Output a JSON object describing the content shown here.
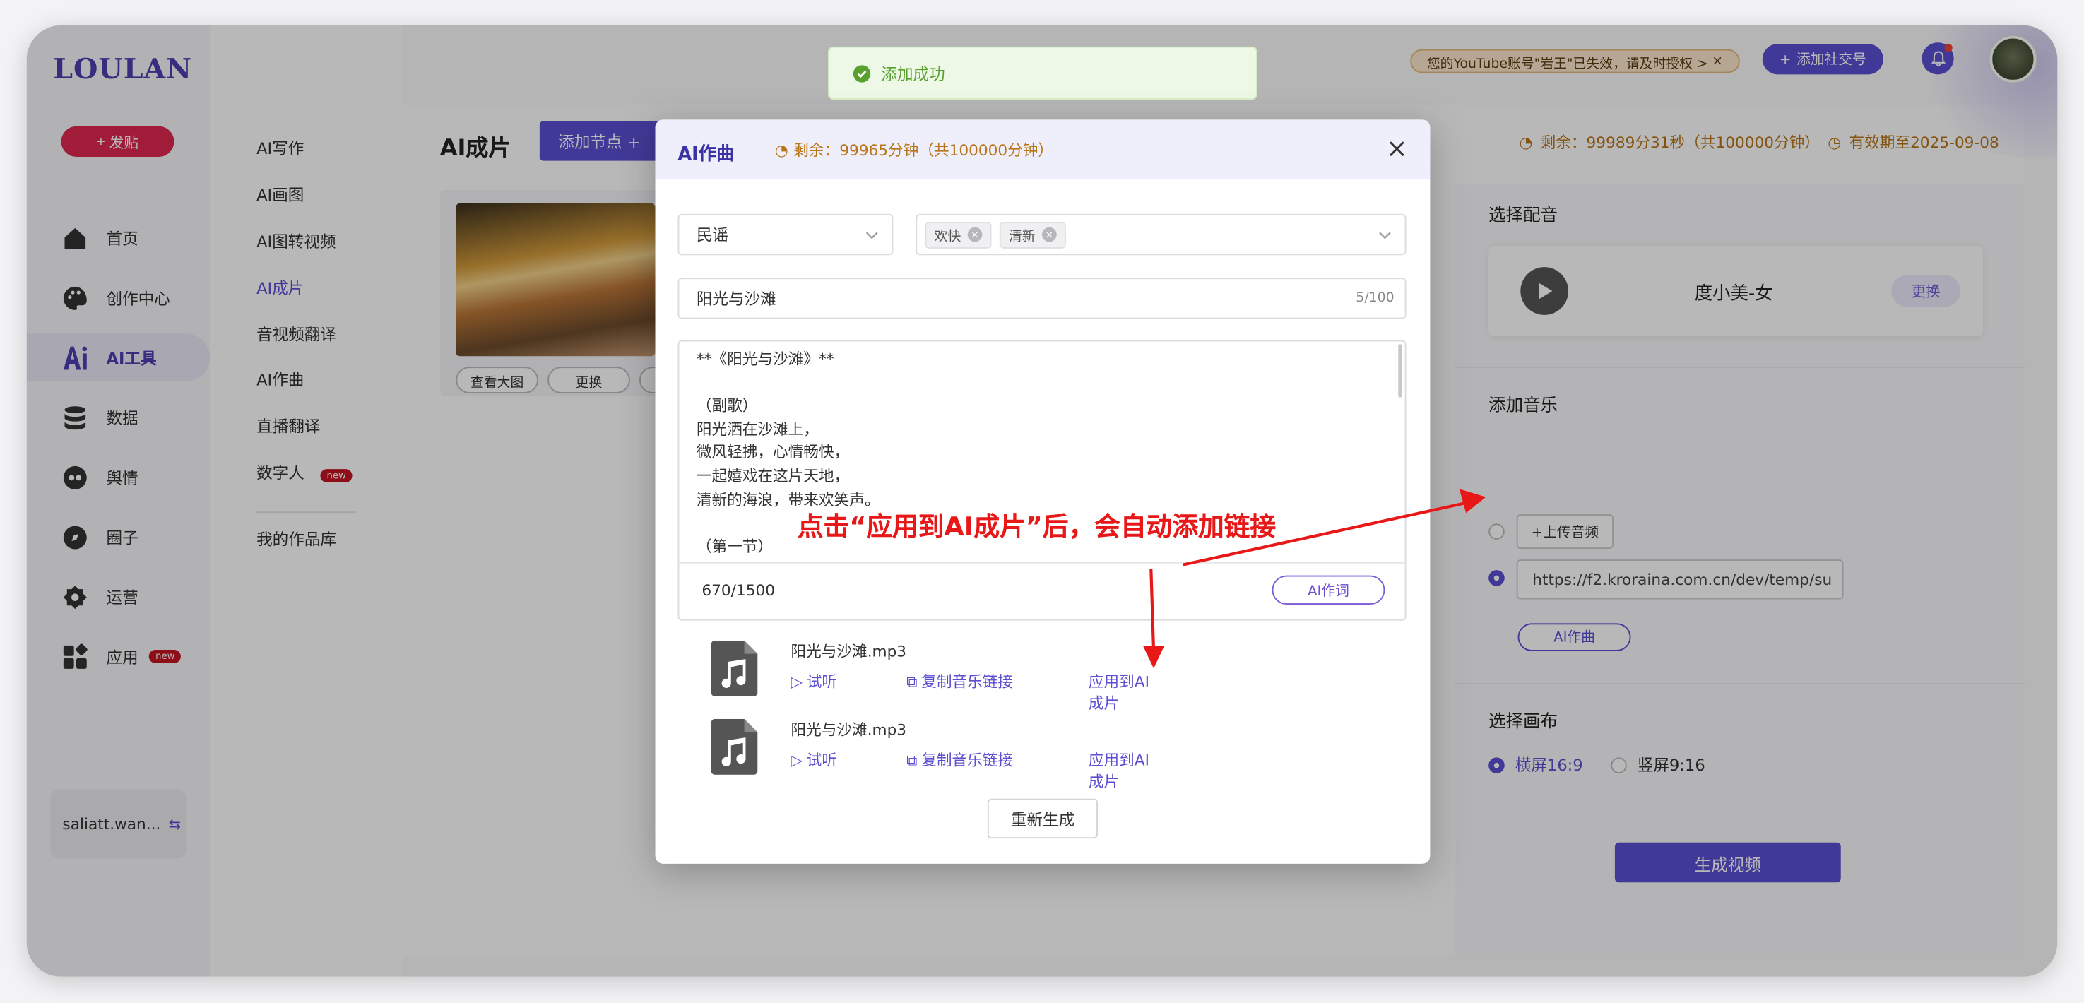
{
  "app": {
    "logo": "LOULAN",
    "post_label": "发贴"
  },
  "nav": [
    {
      "label": "首页",
      "icon": "home-icon"
    },
    {
      "label": "创作中心",
      "icon": "palette-icon"
    },
    {
      "label": "AI工具",
      "icon": "ai-icon",
      "active": true
    },
    {
      "label": "数据",
      "icon": "database-icon"
    },
    {
      "label": "舆情",
      "icon": "eye-icon"
    },
    {
      "label": "圈子",
      "icon": "compass-icon"
    },
    {
      "label": "运营",
      "icon": "operations-icon"
    },
    {
      "label": "应用",
      "icon": "apps-icon",
      "badge": "new"
    }
  ],
  "user": {
    "name": "saliatt.wan..."
  },
  "submenu": [
    {
      "label": "AI写作"
    },
    {
      "label": "AI画图"
    },
    {
      "label": "AI图转视频"
    },
    {
      "label": "AI成片",
      "active": true
    },
    {
      "label": "音视频翻译"
    },
    {
      "label": "AI作曲"
    },
    {
      "label": "直播翻译"
    },
    {
      "label": "数字人",
      "badge": "new"
    },
    {
      "label": "我的作品库"
    }
  ],
  "topbar": {
    "toast": "添加成功",
    "youtube_alert": "您的YouTube账号\"岩王\"已失效，请及时授权 >",
    "add_social": "添加社交号"
  },
  "main": {
    "title": "AI成片",
    "add_node": "添加节点 +",
    "card_buttons": [
      "查看大图",
      "更换"
    ],
    "remain": "剩余：99989分31秒（共100000分钟）",
    "valid_until": "有效期至2025-09-08"
  },
  "right": {
    "voice_title": "选择配音",
    "voice_name": "度小美-女",
    "voice_change": "更换",
    "music_title": "添加音乐",
    "upload_label": "+上传音频",
    "music_url": "https://f2.kroraina.com.cn/dev/temp/su",
    "ai_song_label": "AI作曲",
    "canvas_title": "选择画布",
    "canvas_options": [
      "横屏16:9",
      "竖屏9:16"
    ],
    "generate_label": "生成视频"
  },
  "modal": {
    "title": "AI作曲",
    "remain": "剩余：99965分钟（共100000分钟）",
    "genre": "民谣",
    "tags": [
      "欢快",
      "清新"
    ],
    "song_title": "阳光与沙滩",
    "title_count": "5/100",
    "lyrics": "**《阳光与沙滩》**\n\n（副歌）\n阳光洒在沙滩上，\n微风轻拂，心情畅快，\n一起嬉戏在这片天地，\n清新的海浪，带来欢笑声。\n\n（第一节）",
    "lyrics_count": "670/1500",
    "ai_lyrics_label": "AI作词",
    "songs": [
      {
        "name": "阳光与沙滩.mp3",
        "listen": "试听",
        "copy": "复制音乐链接",
        "apply": "应用到AI成片"
      },
      {
        "name": "阳光与沙滩.mp3",
        "listen": "试听",
        "copy": "复制音乐链接",
        "apply": "应用到AI成片"
      }
    ],
    "regenerate": "重新生成"
  },
  "annotation": {
    "text": "点击“应用到AI成片”后，会自动添加链接",
    "color": "#e81818"
  },
  "colors": {
    "accent": "#5a4fd1",
    "danger": "#e0284e",
    "success": "#58a12f",
    "warning": "#b87416"
  }
}
